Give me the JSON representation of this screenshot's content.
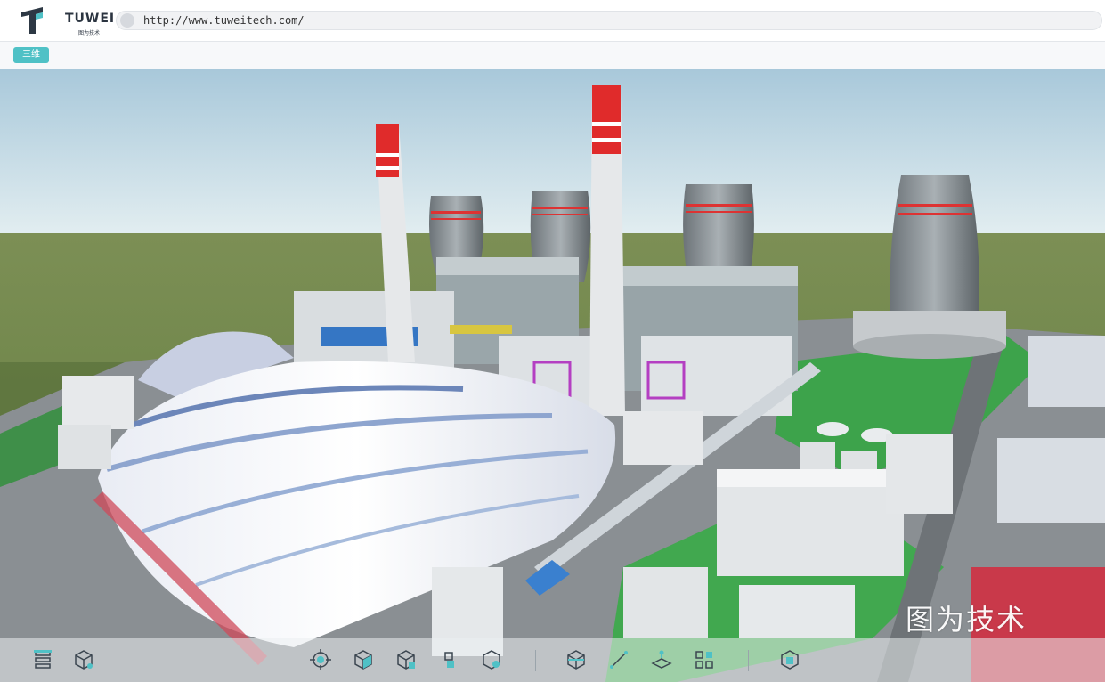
{
  "header": {
    "logo_text": "TUWEI",
    "logo_sub": "图为技术",
    "url": "http://www.tuweitech.com/"
  },
  "subbar": {
    "mode_label": "三维"
  },
  "viewport": {
    "watermark": "图为技术"
  },
  "toolbar": {
    "tools": [
      "layers-icon",
      "cube-info-icon",
      "locate-target-icon",
      "cube-solid-icon",
      "cube-measure-icon",
      "cube-explode-icon",
      "cube-split-icon",
      "section-box-icon",
      "measure-line-icon",
      "floor-plane-icon",
      "component-tree-icon",
      "reset-view-icon"
    ]
  },
  "colors": {
    "accent": "#4fc1c6",
    "sky": "#cfe3ec",
    "grass": "#3da34b",
    "chimney_red": "#e02b2b"
  }
}
